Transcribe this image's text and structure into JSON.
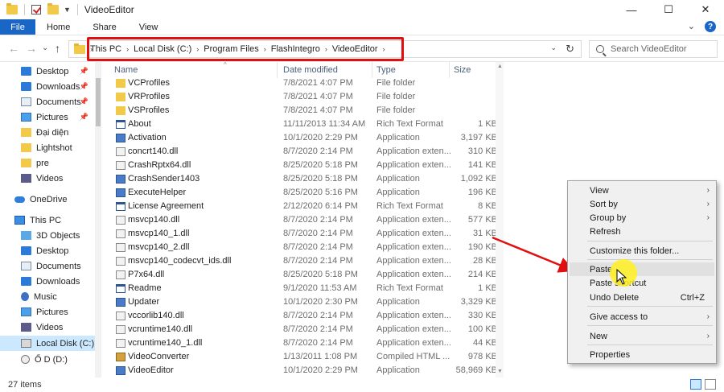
{
  "window": {
    "title": "VideoEditor",
    "controls": {
      "minimize": "—",
      "maximize": "☐",
      "close": "✕"
    }
  },
  "ribbon": {
    "file_label": "File",
    "tabs": [
      "Home",
      "Share",
      "View"
    ],
    "expand_icon": "⌄",
    "help_label": "?"
  },
  "nav": {
    "back": "←",
    "forward": "→",
    "recent": "⌄",
    "up": "↑",
    "breadcrumbs": [
      "This PC",
      "Local Disk (C:)",
      "Program Files",
      "FlashIntegro",
      "VideoEditor"
    ],
    "crumb_sep": "›",
    "dropdown": "⌄",
    "refresh": "↻",
    "search_placeholder": "Search VideoEditor"
  },
  "sidebar": {
    "items": [
      {
        "label": "Desktop",
        "icon": "desktop-icon",
        "pinned": true
      },
      {
        "label": "Downloads",
        "icon": "downloads-icon",
        "pinned": true
      },
      {
        "label": "Documents",
        "icon": "documents-icon",
        "pinned": true
      },
      {
        "label": "Pictures",
        "icon": "pictures-icon",
        "pinned": true
      },
      {
        "label": "Đại diện",
        "icon": "folder-icon",
        "pinned": false
      },
      {
        "label": "Lightshot",
        "icon": "folder-icon",
        "pinned": false
      },
      {
        "label": "pre",
        "icon": "folder-icon",
        "pinned": false
      },
      {
        "label": "Videos",
        "icon": "videos-icon",
        "pinned": false
      },
      {
        "label": "OneDrive",
        "icon": "onedrive-icon",
        "pinned": false
      },
      {
        "label": "This PC",
        "icon": "this-pc-icon",
        "pinned": false
      },
      {
        "label": "3D Objects",
        "icon": "3d-objects-icon",
        "pinned": false
      },
      {
        "label": "Desktop",
        "icon": "desktop-icon",
        "pinned": false
      },
      {
        "label": "Documents",
        "icon": "documents-icon",
        "pinned": false
      },
      {
        "label": "Downloads",
        "icon": "downloads-icon",
        "pinned": false
      },
      {
        "label": "Music",
        "icon": "music-icon",
        "pinned": false
      },
      {
        "label": "Pictures",
        "icon": "pictures-icon",
        "pinned": false
      },
      {
        "label": "Videos",
        "icon": "videos-icon",
        "pinned": false
      },
      {
        "label": "Local Disk (C:)",
        "icon": "local-disk-icon",
        "pinned": false,
        "selected": true
      },
      {
        "label": "Ổ D (D:)",
        "icon": "dvd-drive-icon",
        "pinned": false
      }
    ],
    "pin_glyph": "📌"
  },
  "filelist": {
    "columns": [
      "Name",
      "Date modified",
      "Type",
      "Size"
    ],
    "sort_glyph": "^",
    "rows": [
      {
        "name": "VCProfiles",
        "date": "7/8/2021 4:07 PM",
        "type": "File folder",
        "size": "",
        "icon": "folder-icon"
      },
      {
        "name": "VRProfiles",
        "date": "7/8/2021 4:07 PM",
        "type": "File folder",
        "size": "",
        "icon": "folder-icon"
      },
      {
        "name": "VSProfiles",
        "date": "7/8/2021 4:07 PM",
        "type": "File folder",
        "size": "",
        "icon": "folder-icon"
      },
      {
        "name": "About",
        "date": "11/11/2013 11:34 AM",
        "type": "Rich Text Format",
        "size": "1 KB",
        "icon": "rtf-icon"
      },
      {
        "name": "Activation",
        "date": "10/1/2020 2:29 PM",
        "type": "Application",
        "size": "3,197 KB",
        "icon": "app-icon"
      },
      {
        "name": "concrt140.dll",
        "date": "8/7/2020 2:14 PM",
        "type": "Application exten...",
        "size": "310 KB",
        "icon": "dll-icon"
      },
      {
        "name": "CrashRptx64.dll",
        "date": "8/25/2020 5:18 PM",
        "type": "Application exten...",
        "size": "141 KB",
        "icon": "dll-icon"
      },
      {
        "name": "CrashSender1403",
        "date": "8/25/2020 5:18 PM",
        "type": "Application",
        "size": "1,092 KB",
        "icon": "app-icon"
      },
      {
        "name": "ExecuteHelper",
        "date": "8/25/2020 5:16 PM",
        "type": "Application",
        "size": "196 KB",
        "icon": "app-icon"
      },
      {
        "name": "License Agreement",
        "date": "2/12/2020 6:14 PM",
        "type": "Rich Text Format",
        "size": "8 KB",
        "icon": "rtf-icon"
      },
      {
        "name": "msvcp140.dll",
        "date": "8/7/2020 2:14 PM",
        "type": "Application exten...",
        "size": "577 KB",
        "icon": "dll-icon"
      },
      {
        "name": "msvcp140_1.dll",
        "date": "8/7/2020 2:14 PM",
        "type": "Application exten...",
        "size": "31 KB",
        "icon": "dll-icon"
      },
      {
        "name": "msvcp140_2.dll",
        "date": "8/7/2020 2:14 PM",
        "type": "Application exten...",
        "size": "190 KB",
        "icon": "dll-icon"
      },
      {
        "name": "msvcp140_codecvt_ids.dll",
        "date": "8/7/2020 2:14 PM",
        "type": "Application exten...",
        "size": "28 KB",
        "icon": "dll-icon"
      },
      {
        "name": "P7x64.dll",
        "date": "8/25/2020 5:18 PM",
        "type": "Application exten...",
        "size": "214 KB",
        "icon": "dll-icon"
      },
      {
        "name": "Readme",
        "date": "9/1/2020 11:53 AM",
        "type": "Rich Text Format",
        "size": "1 KB",
        "icon": "rtf-icon"
      },
      {
        "name": "Updater",
        "date": "10/1/2020 2:30 PM",
        "type": "Application",
        "size": "3,329 KB",
        "icon": "app-icon"
      },
      {
        "name": "vccorlib140.dll",
        "date": "8/7/2020 2:14 PM",
        "type": "Application exten...",
        "size": "330 KB",
        "icon": "dll-icon"
      },
      {
        "name": "vcruntime140.dll",
        "date": "8/7/2020 2:14 PM",
        "type": "Application exten...",
        "size": "100 KB",
        "icon": "dll-icon"
      },
      {
        "name": "vcruntime140_1.dll",
        "date": "8/7/2020 2:14 PM",
        "type": "Application exten...",
        "size": "44 KB",
        "icon": "dll-icon"
      },
      {
        "name": "VideoConverter",
        "date": "1/13/2011 1:08 PM",
        "type": "Compiled HTML ...",
        "size": "978 KB",
        "icon": "chm-icon"
      },
      {
        "name": "VideoEditor",
        "date": "10/1/2020 2:29 PM",
        "type": "Application",
        "size": "58,969 KB",
        "icon": "app-icon"
      }
    ]
  },
  "status": {
    "item_count": "27 items"
  },
  "context_menu": {
    "items": [
      {
        "label": "View",
        "submenu": true
      },
      {
        "label": "Sort by",
        "submenu": true
      },
      {
        "label": "Group by",
        "submenu": true
      },
      {
        "label": "Refresh"
      },
      {
        "label": "Customize this folder..."
      },
      {
        "label": "Paste",
        "hover": true
      },
      {
        "label": "Paste shortcut"
      },
      {
        "label": "Undo Delete",
        "shortcut": "Ctrl+Z"
      },
      {
        "label": "Give access to",
        "submenu": true
      },
      {
        "label": "New",
        "submenu": true
      },
      {
        "label": "Properties"
      }
    ],
    "arrow_glyph": "›"
  },
  "colors": {
    "accent": "#1a66c7",
    "highlight_box": "#e01010",
    "arrow": "#e01010",
    "spotlight": "#fff01e",
    "selection": "#cce8ff"
  }
}
